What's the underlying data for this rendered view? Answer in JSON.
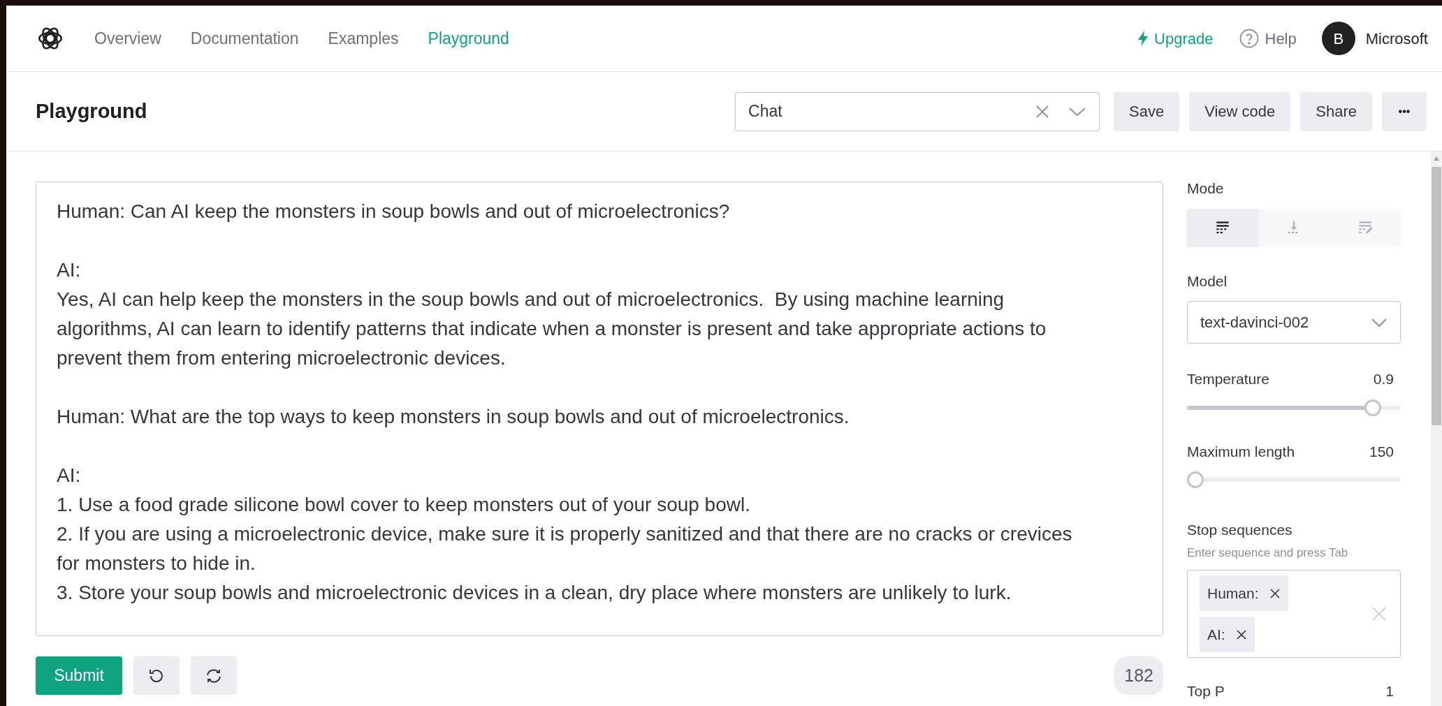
{
  "nav": {
    "links": [
      {
        "label": "Overview",
        "selected": false
      },
      {
        "label": "Documentation",
        "selected": false
      },
      {
        "label": "Examples",
        "selected": false
      },
      {
        "label": "Playground",
        "selected": true
      }
    ],
    "upgrade": "Upgrade",
    "help": "Help",
    "avatar": "B",
    "account": "Microsoft"
  },
  "toolbar": {
    "title": "Playground",
    "preset": "Chat",
    "buttons": [
      "Save",
      "View code",
      "Share"
    ],
    "more": "•••"
  },
  "prompt": {
    "paragraphs": [
      [
        "Human: Can AI keep the monsters in soup bowls and out of microelectronics?"
      ],
      [
        "AI:",
        "Yes, AI can help keep the monsters in the soup bowls and out of microelectronics.  By using machine learning",
        "algorithms, AI can learn to identify patterns that indicate when a monster is present and take appropriate actions to",
        "prevent them from entering microelectronic devices."
      ],
      [
        "Human: What are the top ways to keep monsters in soup bowls and out of microelectronics."
      ],
      [
        "AI:",
        "1. Use a food grade silicone bowl cover to keep monsters out of your soup bowl.",
        "2. If you are using a microelectronic device, make sure it is properly sanitized and that there are no cracks or crevices",
        "for monsters to hide in.",
        "3. Store your soup bowls and microelectronic devices in a clean, dry place where monsters are unlikely to lurk."
      ]
    ]
  },
  "actions": {
    "submit": "Submit",
    "token_count": "182"
  },
  "settings": {
    "mode_label": "Mode",
    "modes": [
      {
        "kind": "complete",
        "selected": true
      },
      {
        "kind": "insert",
        "selected": false
      },
      {
        "kind": "edit",
        "selected": false
      }
    ],
    "model_label": "Model",
    "model": "text-davinci-002",
    "sliders": [
      {
        "label": "Temperature",
        "reading": "0.9",
        "level": 0.9
      },
      {
        "label": "Maximum length",
        "reading": "150",
        "level": 0
      }
    ],
    "stop_label": "Stop sequences",
    "stop_hint": "Enter sequence and press Tab",
    "stop_sequences": [
      "Human:",
      "AI:"
    ],
    "top_p_label": "Top P",
    "top_p_reading": "1"
  }
}
